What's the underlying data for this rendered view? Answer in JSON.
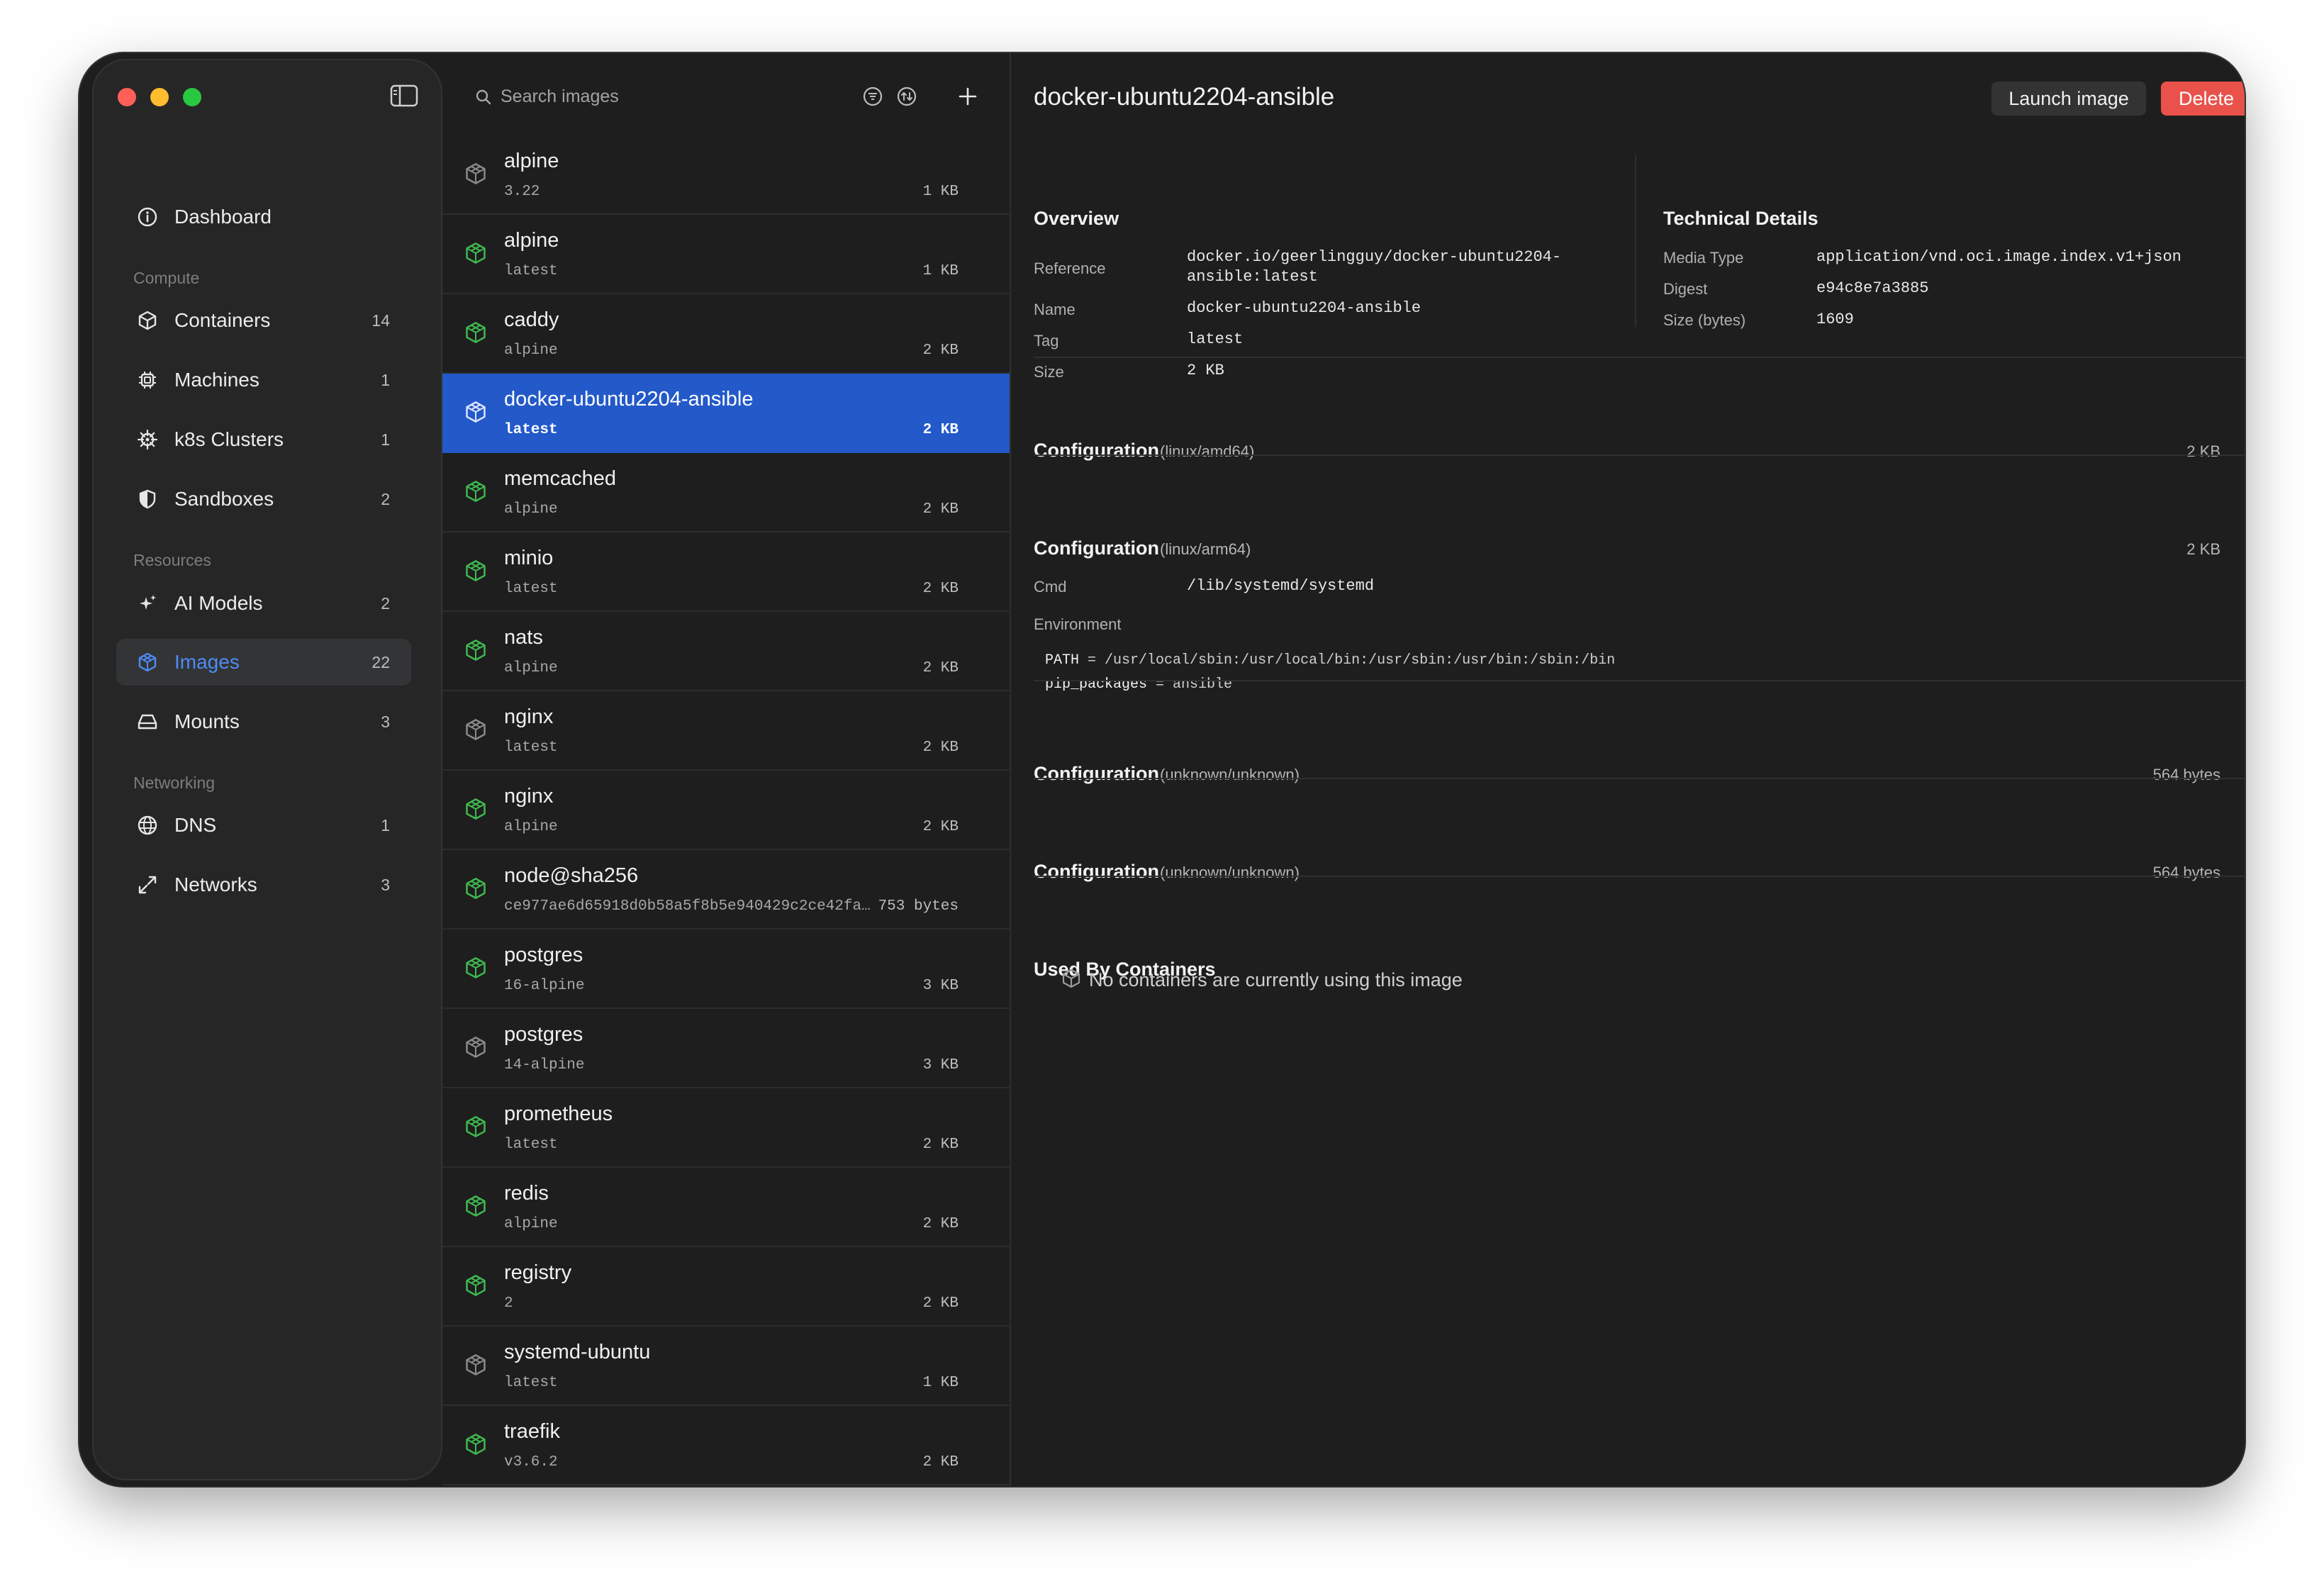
{
  "sidebar": {
    "items": [
      {
        "label": "Dashboard",
        "count": ""
      },
      {
        "label": "Containers",
        "count": "14"
      },
      {
        "label": "Machines",
        "count": "1"
      },
      {
        "label": "k8s Clusters",
        "count": "1"
      },
      {
        "label": "Sandboxes",
        "count": "2"
      },
      {
        "label": "AI Models",
        "count": "2"
      },
      {
        "label": "Images",
        "count": "22"
      },
      {
        "label": "Mounts",
        "count": "3"
      },
      {
        "label": "DNS",
        "count": "1"
      },
      {
        "label": "Networks",
        "count": "3"
      }
    ],
    "sections": [
      "Compute",
      "Resources",
      "Networking"
    ],
    "active_item": "Images"
  },
  "list": {
    "search_placeholder": "Search images",
    "images": [
      {
        "name": "alpine",
        "tag": "3.22",
        "size": "1 KB",
        "status": "unused"
      },
      {
        "name": "alpine",
        "tag": "latest",
        "size": "1 KB",
        "status": "in-use"
      },
      {
        "name": "caddy",
        "tag": "alpine",
        "size": "2 KB",
        "status": "in-use"
      },
      {
        "name": "docker-ubuntu2204-ansible",
        "tag": "latest",
        "size": "2 KB",
        "status": "selected"
      },
      {
        "name": "memcached",
        "tag": "alpine",
        "size": "2 KB",
        "status": "in-use"
      },
      {
        "name": "minio",
        "tag": "latest",
        "size": "2 KB",
        "status": "in-use"
      },
      {
        "name": "nats",
        "tag": "alpine",
        "size": "2 KB",
        "status": "in-use"
      },
      {
        "name": "nginx",
        "tag": "latest",
        "size": "2 KB",
        "status": "unused"
      },
      {
        "name": "nginx",
        "tag": "alpine",
        "size": "2 KB",
        "status": "in-use"
      },
      {
        "name": "node@sha256",
        "tag": "ce977ae6d65918d0b58a5f8b5e940429c2ce42fa…",
        "size": "753 bytes",
        "status": "in-use"
      },
      {
        "name": "postgres",
        "tag": "16-alpine",
        "size": "3 KB",
        "status": "in-use"
      },
      {
        "name": "postgres",
        "tag": "14-alpine",
        "size": "3 KB",
        "status": "unused"
      },
      {
        "name": "prometheus",
        "tag": "latest",
        "size": "2 KB",
        "status": "in-use"
      },
      {
        "name": "redis",
        "tag": "alpine",
        "size": "2 KB",
        "status": "in-use"
      },
      {
        "name": "registry",
        "tag": "2",
        "size": "2 KB",
        "status": "in-use"
      },
      {
        "name": "systemd-ubuntu",
        "tag": "latest",
        "size": "1 KB",
        "status": "unused"
      },
      {
        "name": "traefik",
        "tag": "v3.6.2",
        "size": "2 KB",
        "status": "in-use"
      }
    ]
  },
  "detail": {
    "title": "docker-ubuntu2204-ansible",
    "launch_label": "Launch image",
    "delete_label": "Delete",
    "overview": {
      "heading": "Overview",
      "reference_label": "Reference",
      "reference_line1": "docker.io/geerlingguy/docker-ubuntu2204-",
      "reference_line2": "ansible:latest",
      "name_label": "Name",
      "name_value": "docker-ubuntu2204-ansible",
      "tag_label": "Tag",
      "tag_value": "latest",
      "size_label": "Size",
      "size_value": "2 KB"
    },
    "technical": {
      "heading": "Technical Details",
      "media_type_label": "Media Type",
      "media_type_value": "application/vnd.oci.image.index.v1+json",
      "digest_label": "Digest",
      "digest_value": "e94c8e7a3885",
      "size_label": "Size (bytes)",
      "size_value": "1609"
    },
    "configs": [
      {
        "label": "Configuration",
        "platform": "(linux/amd64)",
        "size": "2 KB"
      },
      {
        "label": "Configuration",
        "platform": "(linux/arm64)",
        "size": "2 KB"
      },
      {
        "label": "Configuration",
        "platform": "(unknown/unknown)",
        "size": "564 bytes"
      },
      {
        "label": "Configuration",
        "platform": "(unknown/unknown)",
        "size": "564 bytes"
      }
    ],
    "arm64": {
      "cmd_label": "Cmd",
      "cmd_value": "/lib/systemd/systemd",
      "env_label": "Environment",
      "env": [
        {
          "key": "PATH",
          "eq": " = ",
          "value": "/usr/local/sbin:/usr/local/bin:/usr/sbin:/usr/bin:/sbin:/bin"
        },
        {
          "key": "pip_packages",
          "eq": " = ",
          "value": "ansible"
        }
      ]
    },
    "used_by": {
      "heading": "Used By Containers",
      "empty": "No containers are currently using this image"
    }
  },
  "colors": {
    "accent": "#2359c9",
    "active_label": "#4c8cf5",
    "in_use_icon": "#3fb950",
    "unused_icon": "#8a8a8a",
    "delete": "#e9524a"
  }
}
